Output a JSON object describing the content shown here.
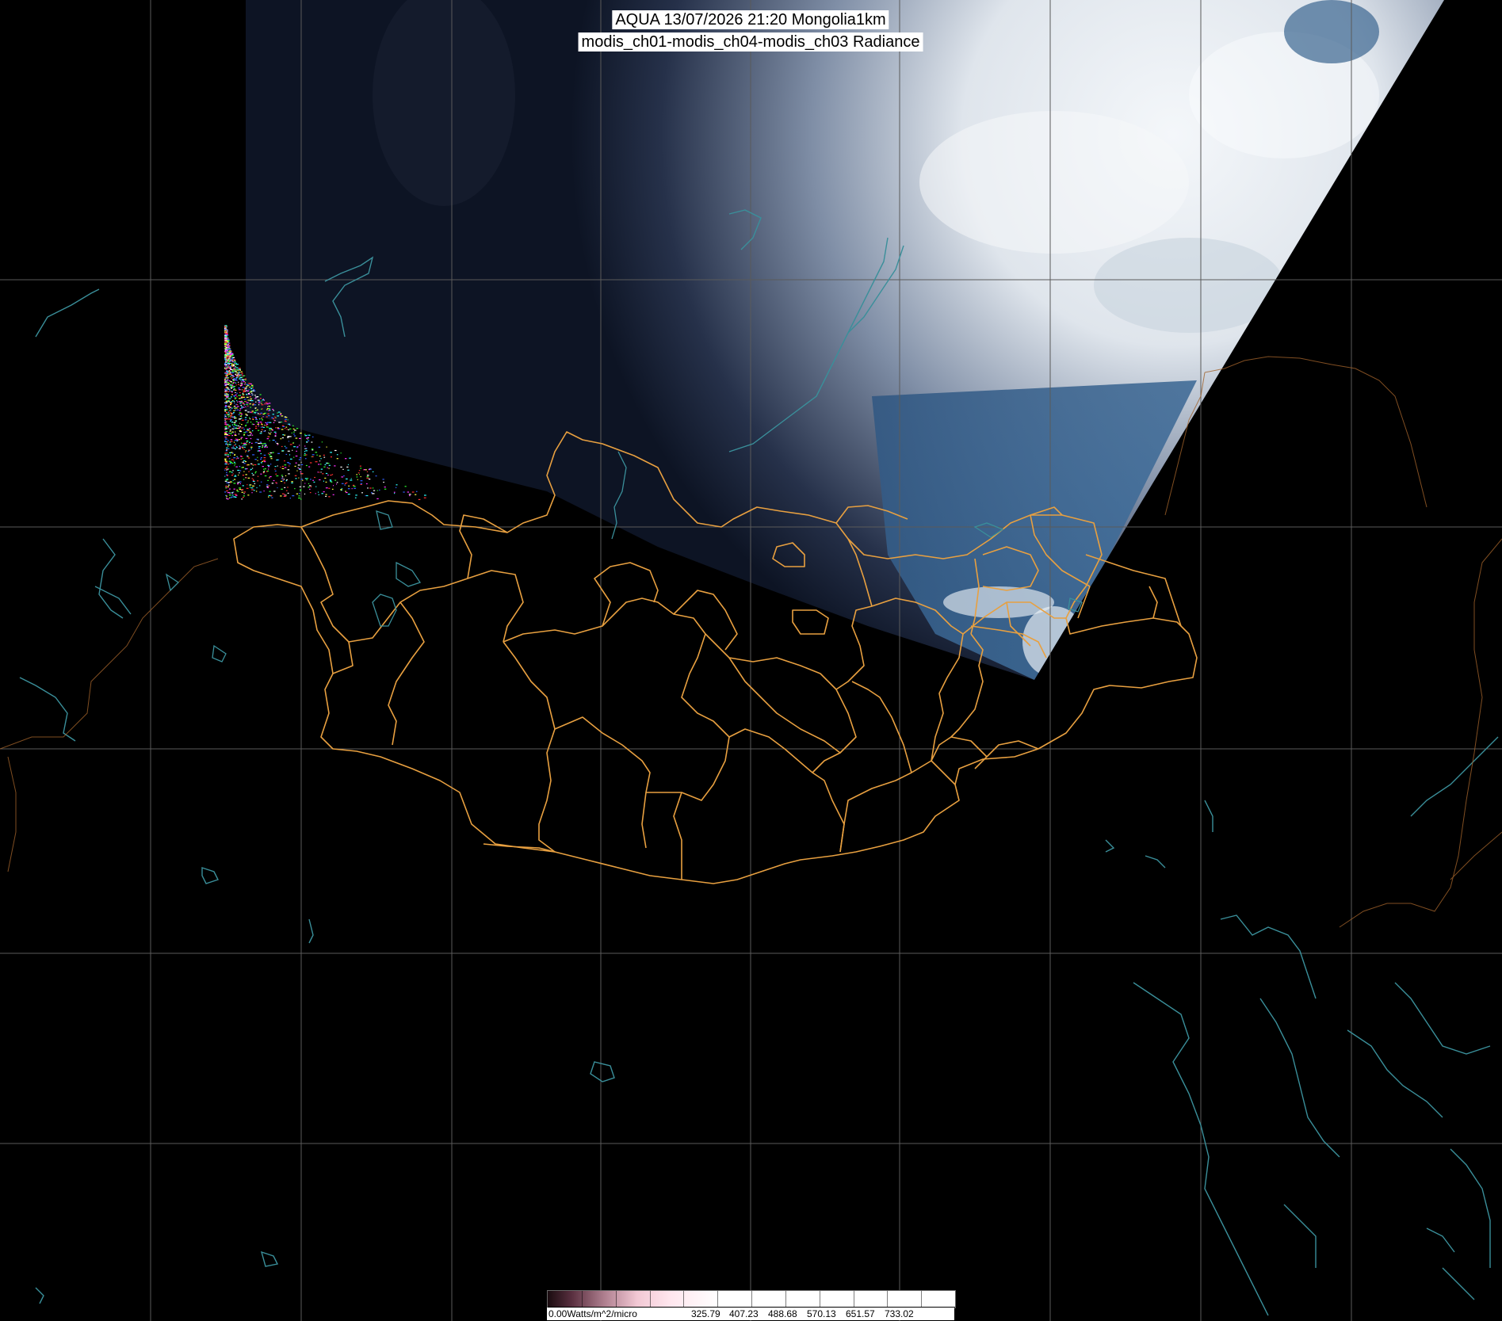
{
  "title": {
    "line1": "AQUA 13/07/2026 21:20 Mongolia1km",
    "line2": "modis_ch01-modis_ch04-modis_ch03 Radiance"
  },
  "colorbar": {
    "labels": [
      "0.00Watts/m^2/micro",
      "325.79",
      "407.23",
      "488.68",
      "570.13",
      "651.57",
      "733.02"
    ]
  },
  "colors": {
    "background": "#000000",
    "grid": "#5a5a5a",
    "province_border": "#e8a040",
    "coastline": "#3a8f9a",
    "cloud": "#e8edf2",
    "land_night": "#0c1020"
  },
  "layers": [
    "satellite-swath",
    "graticule",
    "mongolia-province-borders",
    "coastlines-and-lakes",
    "noise-artifact"
  ]
}
